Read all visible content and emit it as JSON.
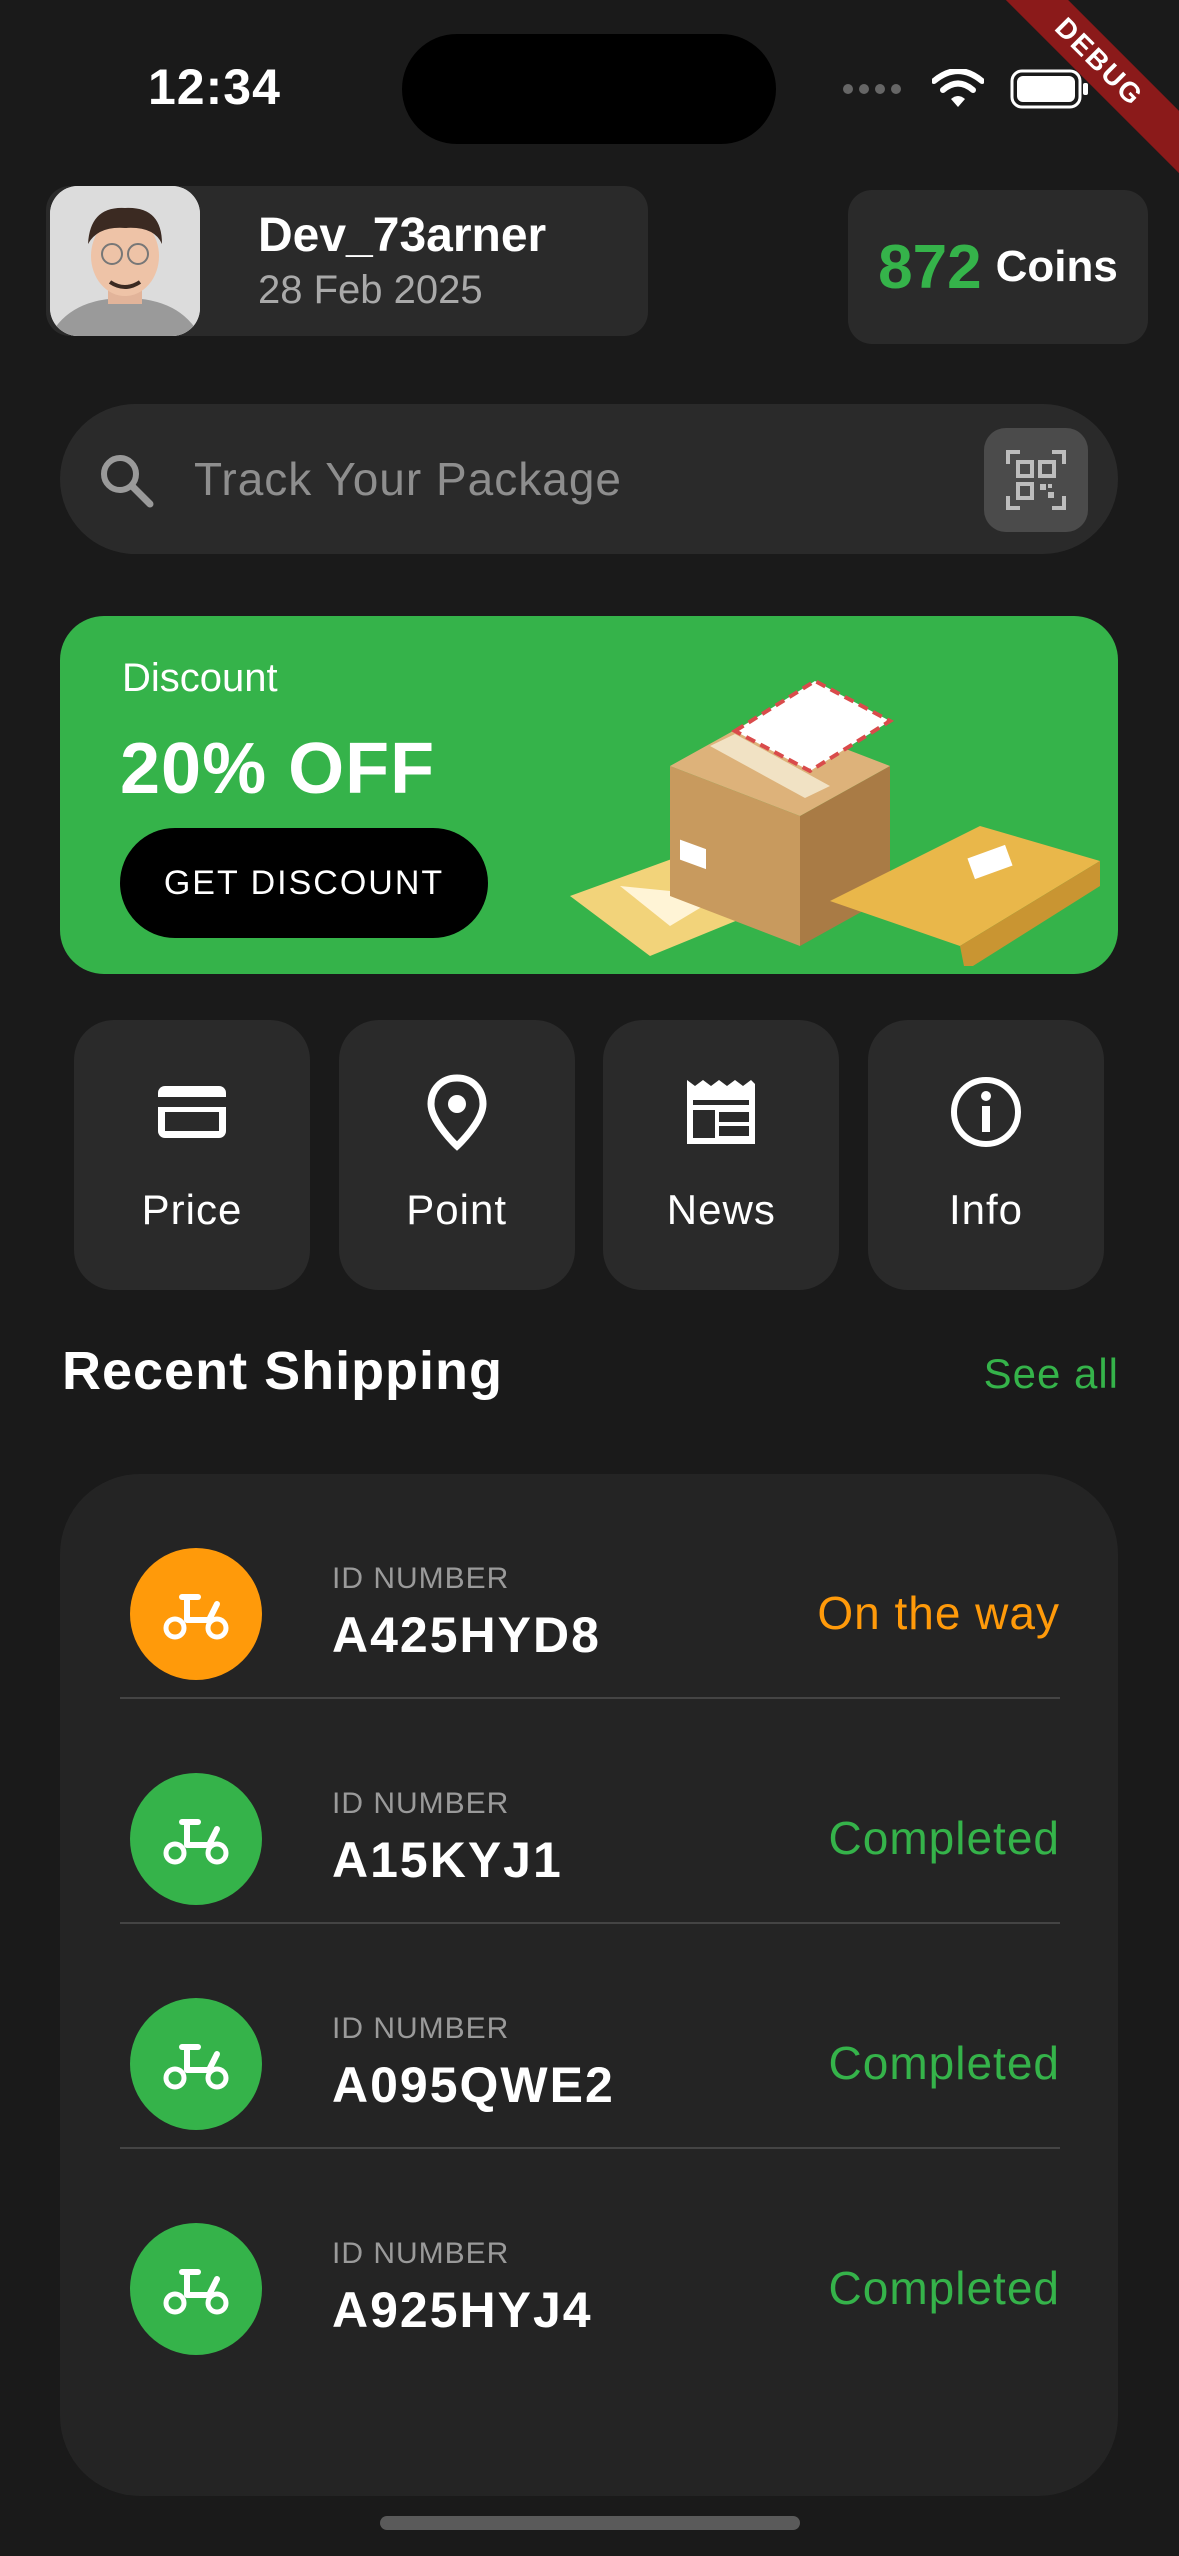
{
  "status_bar": {
    "time": "12:34",
    "debug_label": "DEBUG"
  },
  "profile": {
    "username": "Dev_73arner",
    "date": "28 Feb 2025"
  },
  "coins": {
    "value": "872",
    "label": "Coins"
  },
  "search": {
    "placeholder": "Track Your Package"
  },
  "banner": {
    "eyebrow": "Discount",
    "title": "20% OFF",
    "button_label": "GET DISCOUNT"
  },
  "quick_actions": [
    {
      "label": "Price",
      "icon": "credit-card-icon"
    },
    {
      "label": "Point",
      "icon": "location-pin-icon"
    },
    {
      "label": "News",
      "icon": "newspaper-icon"
    },
    {
      "label": "Info",
      "icon": "info-icon"
    }
  ],
  "recent": {
    "title": "Recent Shipping",
    "see_all": "See all",
    "id_label": "ID NUMBER",
    "items": [
      {
        "id": "A425HYD8",
        "status": "On the way",
        "color": "#ff9a0a"
      },
      {
        "id": "A15KYJ1",
        "status": "Completed",
        "color": "#35b34a"
      },
      {
        "id": "A095QWE2",
        "status": "Completed",
        "color": "#35b34a"
      },
      {
        "id": "A925HYJ4",
        "status": "Completed",
        "color": "#35b34a"
      }
    ]
  },
  "colors": {
    "accent": "#35b34a",
    "warning": "#ff9a0a",
    "background": "#1a1a1a",
    "card": "#2a2a2a"
  }
}
